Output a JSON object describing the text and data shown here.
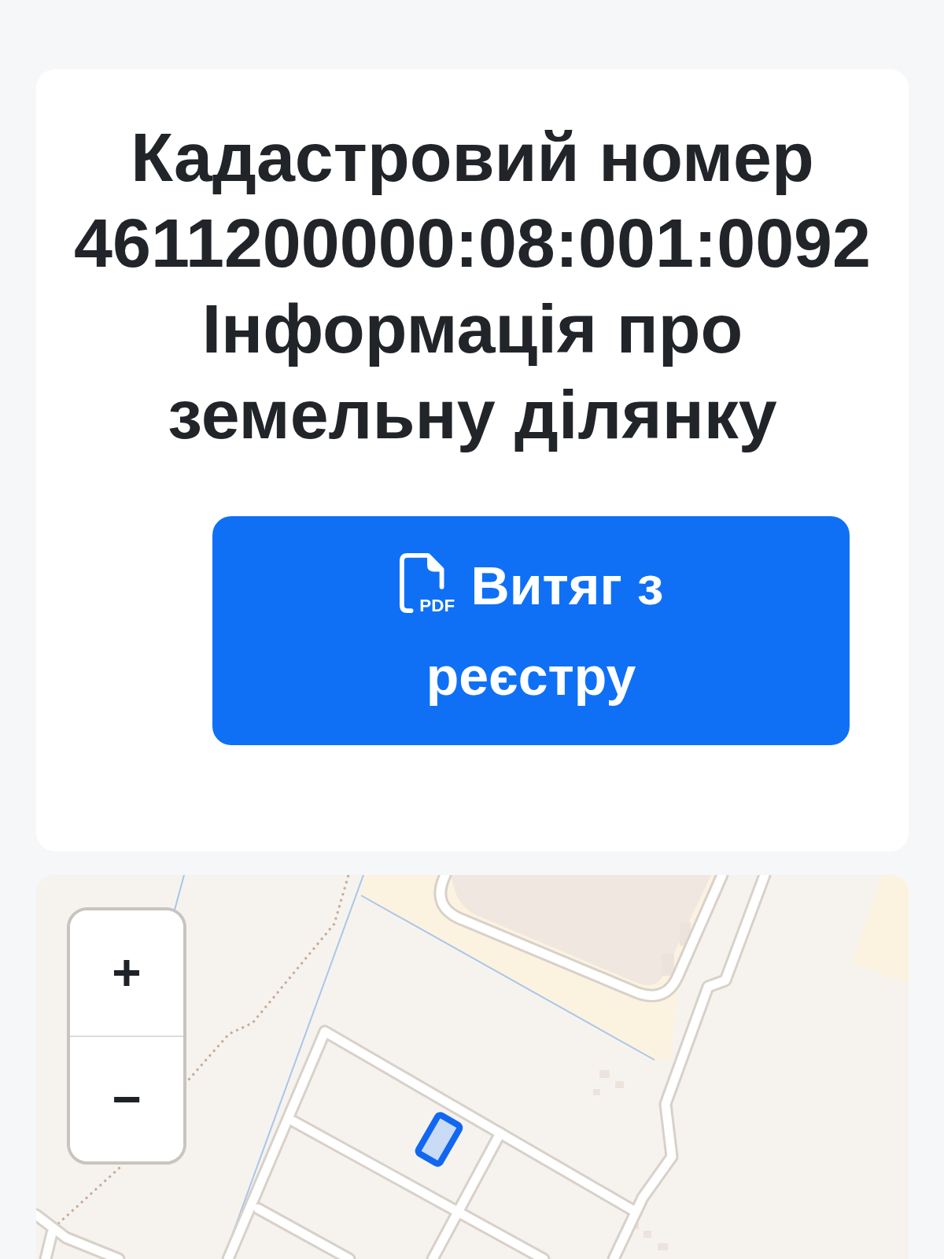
{
  "card": {
    "title_lines": [
      "Кадастровий номер",
      "4611200000:08:001:0092",
      "Інформація про",
      "земельну ділянку"
    ],
    "button": {
      "icon_text": "PDF",
      "label_lines": [
        "Витяг з",
        "реєстру"
      ]
    }
  },
  "map": {
    "zoom_in": "+",
    "zoom_out": "−"
  }
}
